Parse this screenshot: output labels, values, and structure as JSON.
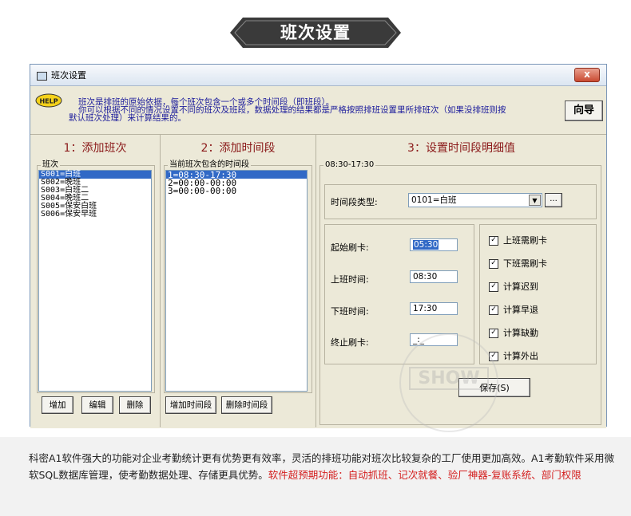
{
  "banner": {
    "title": "班次设置"
  },
  "window": {
    "title": "班次设置",
    "close_label": "x"
  },
  "help": {
    "icon_text": "HELP"
  },
  "info": {
    "line1": "班次是排班的原始依据，每个班次包含一个或多个时间段（即班段）。",
    "line2": "你可以根据不同的情况设置不同的班次及班段，数据处理的结果都是严格按照排班设置里所排班次（如果没排班则按",
    "line3": "默认班次处理）来计算结果的。"
  },
  "wizard_label": "向导",
  "panel1": {
    "header": "1：添加班次",
    "group_label": "班次",
    "items": [
      "S001=白班",
      "S002=晚班",
      "S003=白班二",
      "S004=晚班二",
      "S005=保安白班",
      "S006=保安早班"
    ],
    "selected_index": 0,
    "add_label": "增加",
    "edit_label": "编辑",
    "delete_label": "删除"
  },
  "panel2": {
    "header": "2：添加时间段",
    "group_label": "当前班次包含的时间段",
    "items": [
      "1=08:30-17:30",
      "2=00:00-00:00",
      "3=00:00-00:00"
    ],
    "selected_index": 0,
    "add_label": "增加时间段",
    "delete_label": "删除时间段"
  },
  "panel3": {
    "header": "3：设置时间段明细值",
    "group_label": "08:30-17:30",
    "type_label": "时间段类型:",
    "type_value": "0101=白班",
    "browse_label": "...",
    "start_swipe_label": "起始刷卡:",
    "start_swipe_value": "05:30",
    "on_duty_label": "上班时间:",
    "on_duty_value": "08:30",
    "off_duty_label": "下班时间:",
    "off_duty_value": "17:30",
    "end_swipe_label": "终止刷卡:",
    "end_swipe_value": "_:_",
    "checks": [
      {
        "label": "上班需刷卡",
        "checked": true
      },
      {
        "label": "下班需刷卡",
        "checked": true
      },
      {
        "label": "计算迟到",
        "checked": true
      },
      {
        "label": "计算早退",
        "checked": true
      },
      {
        "label": "计算缺勤",
        "checked": true
      },
      {
        "label": "计算外出",
        "checked": true
      }
    ],
    "save_label": "保存(S)"
  },
  "watermark": {
    "text": "SHOW"
  },
  "footer": {
    "text1": "科密A1软件强大的功能对企业考勤统计更有优势更有效率，灵活的排班功能对班次比较复杂的工厂使用更加高效。A1考勤软件采用微软SQL数据库管理，使考勤数据处理、存储更具优势。",
    "text2": "软件超预期功能：自动抓班、记次就餐、验厂神器-复账系统、部门权限"
  },
  "colors": {
    "banner": "#3a3a3a",
    "header_red": "#8b1a1a",
    "info_blue": "#1d1d9c",
    "select_blue": "#3169c6",
    "footer_red": "#d42020"
  }
}
